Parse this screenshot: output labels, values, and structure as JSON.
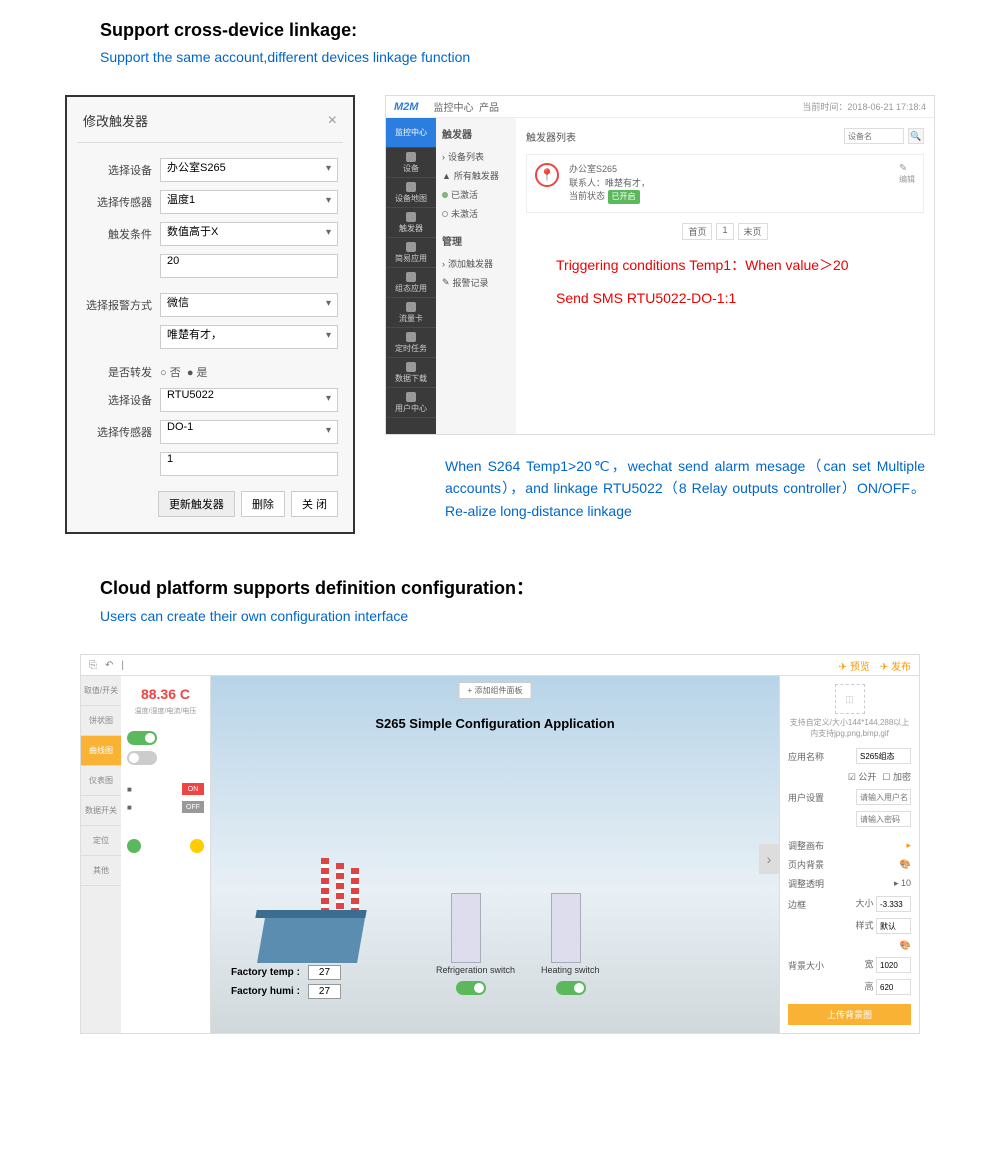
{
  "section1": {
    "title": "Support cross-device linkage:",
    "subtitle": "Support the same account,different devices linkage function"
  },
  "dialog": {
    "title": "修改触发器",
    "labels": {
      "device": "选择设备",
      "sensor": "选择传感器",
      "condition": "触发条件",
      "alarm": "选择报警方式",
      "forward": "是否转发",
      "device2": "选择设备",
      "sensor2": "选择传感器"
    },
    "values": {
      "device": "办公室S265",
      "sensor": "温度1",
      "condition": "数值高于X",
      "threshold": "20",
      "alarm": "微信",
      "alarm_to": "唯楚有才，",
      "forward_no": "否",
      "forward_yes": "是",
      "device2": "RTU5022",
      "sensor2": "DO-1",
      "do_val": "1"
    },
    "buttons": {
      "update": "更新触发器",
      "delete": "删除",
      "close": "关 闭"
    }
  },
  "m2m": {
    "logo": "M2M",
    "topnav": [
      "监控中心",
      "产品"
    ],
    "timestamp": "当前时间：2018-06-21 17:18:4",
    "side": [
      "监控中心",
      "设备",
      "设备地图",
      "触发器",
      "简易应用",
      "组态应用",
      "流量卡",
      "定时任务",
      "数据下载",
      "用户中心"
    ],
    "nav": {
      "h1": "触发器",
      "items1": [
        "设备列表",
        "所有触发器",
        "已激活",
        "未激活"
      ],
      "h2": "管理",
      "items2": [
        "添加触发器",
        "报警记录"
      ]
    },
    "main": {
      "title": "触发器列表",
      "search_ph": "设备名",
      "device": "办公室S265",
      "contact": "联系人：唯楚有才，",
      "status_label": "当前状态",
      "status": "已开启",
      "edit": "编辑",
      "pager": [
        "首页",
        "1",
        "末页"
      ]
    },
    "annotation1": "Triggering conditions   Temp1：When value＞20",
    "annotation2": "Send SMS   RTU5022-DO-1:1",
    "explain": "When S264 Temp1>20℃，wechat send alarm mesage（can set Multiple accounts），and linkage RTU5022（8 Relay outputs controller）ON/OFF。Re-alize long-distance linkage"
  },
  "section2": {
    "title": "Cloud platform supports definition configuration：",
    "subtitle": "Users can create their own configuration interface"
  },
  "config": {
    "top_r": [
      "预览",
      "发布"
    ],
    "left_tabs": [
      "取值/开关",
      "饼状图",
      "曲线图",
      "仪表图",
      "数据开关",
      "定位",
      "其他"
    ],
    "tools": {
      "temp": "88.36 C",
      "sub": "温度/湿度/电流/电压"
    },
    "canvas": {
      "title": "S265 Simple Configuration Application",
      "add": "+ 添加组件面板",
      "factory_temp_label": "Factory temp :",
      "factory_humi_label": "Factory humi :",
      "temp_val": "27",
      "humi_val": "27",
      "refrig": "Refrigeration switch",
      "heat": "Heating switch"
    },
    "right": {
      "hint": "支持自定义/大小144*144,288以上 内支持jpg,png,bmp,gif",
      "app_name_label": "应用名称",
      "app_name": "S265组态",
      "public": "公开",
      "encrypt": "加密",
      "user_label": "用户设置",
      "user_ph": "请输入用户名",
      "pwd_ph": "请输入密码",
      "bg_label": "调整画布",
      "bgfill_label": "页内背景",
      "opacity_label": "调整透明",
      "opacity": "10",
      "border_label": "边框",
      "border_size": "大小",
      "border_val": "-3.333",
      "style_label": "样式",
      "style_val": "默认",
      "bgsize_label": "背景大小",
      "width_label": "宽",
      "width": "1020",
      "height_label": "高",
      "height": "620",
      "upload": "上传背景图"
    }
  }
}
